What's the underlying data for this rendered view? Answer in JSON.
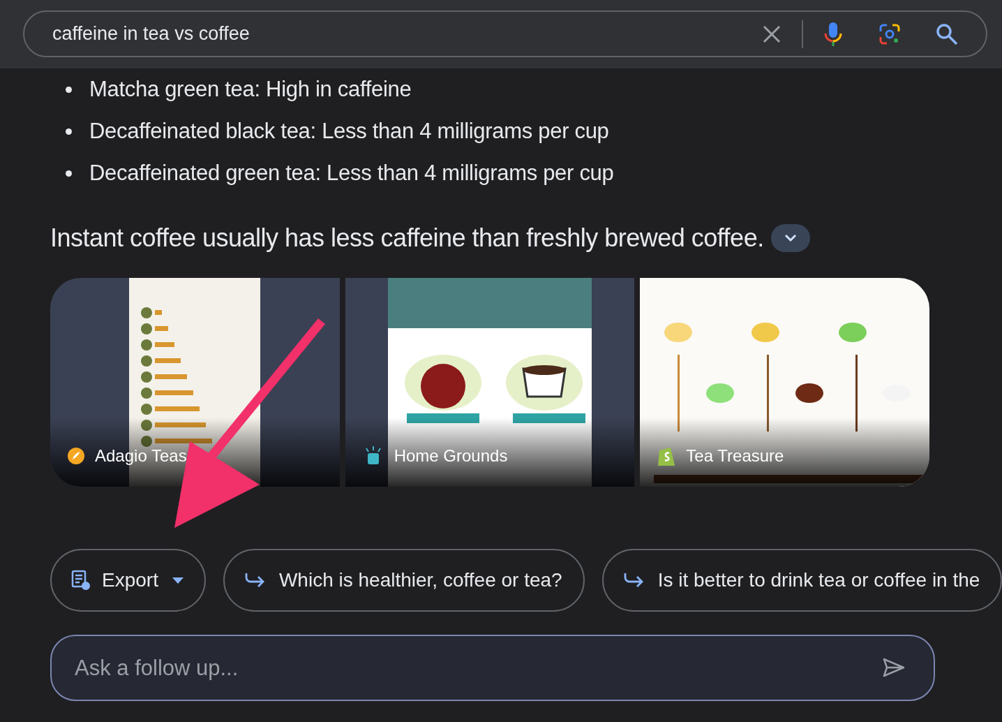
{
  "search": {
    "value": "caffeine in tea vs coffee"
  },
  "bullets": [
    "Matcha green tea: High in caffeine",
    "Decaffeinated black tea: Less than 4 milligrams per cup",
    "Decaffeinated green tea: Less than 4 milligrams per cup"
  ],
  "summary": "Instant coffee usually has less caffeine than freshly brewed coffee.",
  "image_cards": [
    {
      "source": "Adagio Teas",
      "kind": "picture"
    },
    {
      "source": "Home Grounds",
      "kind": "picture"
    },
    {
      "source": "Tea Treasure",
      "kind": "picture"
    }
  ],
  "chips": [
    {
      "kind": "export",
      "label": "Export"
    },
    {
      "kind": "follow_up",
      "label": "Which is healthier, coffee or tea?"
    },
    {
      "kind": "follow_up",
      "label": "Is it better to drink tea or coffee in the"
    }
  ],
  "follow_up": {
    "placeholder": "Ask a follow up..."
  }
}
